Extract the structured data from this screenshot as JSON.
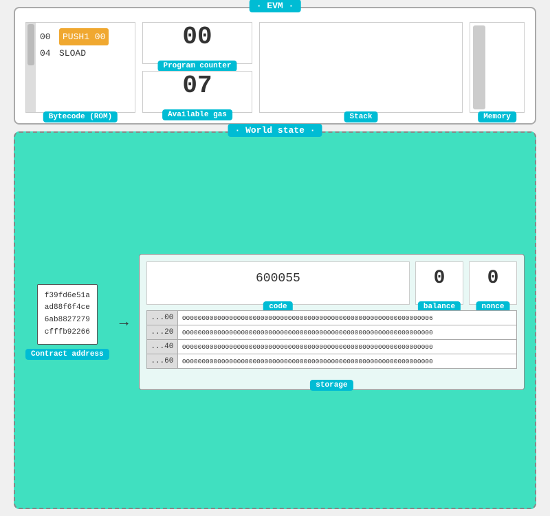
{
  "evm": {
    "title": "· EVM ·",
    "bytecode": {
      "label": "Bytecode (ROM)",
      "rows": [
        {
          "addr": "00",
          "op": "PUSH1 00",
          "highlight": true
        },
        {
          "addr": "04",
          "op": "SLOAD",
          "highlight": false
        }
      ]
    },
    "program_counter": {
      "value": "00",
      "label": "Program counter"
    },
    "available_gas": {
      "value": "07",
      "label": "Available gas"
    },
    "stack": {
      "label": "Stack"
    },
    "memory": {
      "label": "Memory"
    }
  },
  "world_state": {
    "title": "· World state ·",
    "contract": {
      "address_lines": [
        "f39fd6e51a",
        "ad88f6f4ce",
        "6ab8827279",
        "cfffb92266"
      ],
      "label": "Contract address"
    },
    "account": {
      "code": {
        "value": "600055",
        "label": "code"
      },
      "balance": {
        "value": "0",
        "label": "balance"
      },
      "nonce": {
        "value": "0",
        "label": "nonce"
      },
      "storage": {
        "label": "storage",
        "rows": [
          {
            "addr": "...00",
            "val": "0000000000000000000000000000000000000000000000000000000000000006"
          },
          {
            "addr": "...20",
            "val": "0000000000000000000000000000000000000000000000000000000000000000"
          },
          {
            "addr": "...40",
            "val": "0000000000000000000000000000000000000000000000000000000000000000"
          },
          {
            "addr": "...60",
            "val": "0000000000000000000000000000000000000000000000000000000000000000"
          }
        ]
      }
    }
  }
}
